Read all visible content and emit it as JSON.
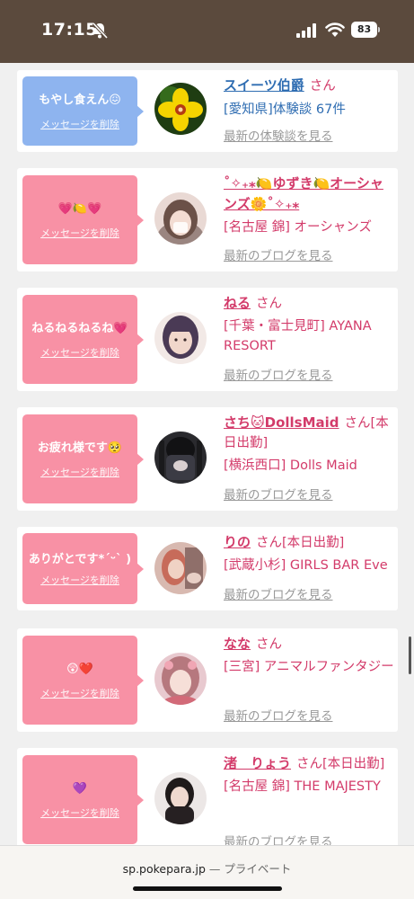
{
  "status_bar": {
    "time": "17:15",
    "battery": "83"
  },
  "feed": [
    {
      "bubble_text": "もやし食えん😖",
      "bubble_color": "#8eb4ef",
      "delete_label": "メッセージを削除",
      "name": "スイーツ伯爵",
      "name_suffix": "さん",
      "area": "[愛知県]体験談 67件",
      "link": "最新の体験談を見る",
      "accent": "blue"
    },
    {
      "bubble_text": "💗🍋💗",
      "bubble_color": "#f891a5",
      "delete_label": "メッセージを削除",
      "name": "˚✧₊⁎🍋ゆずき🍋オーシャンズ🌼˚✧₊⁎",
      "name_suffix": "",
      "area": "[名古屋 錦] オーシャンズ",
      "link": "最新のブログを見る",
      "accent": "pink"
    },
    {
      "bubble_text": "ねるねるねるね💗",
      "bubble_color": "#f891a5",
      "delete_label": "メッセージを削除",
      "name": "ねる",
      "name_suffix": "さん",
      "area": "[千葉・富士見町] AYANA RESORT",
      "link": "最新のブログを見る",
      "accent": "pink"
    },
    {
      "bubble_text": "お疲れ様です🥺",
      "bubble_color": "#f891a5",
      "delete_label": "メッセージを削除",
      "name": "さち🐱DollsMaid",
      "name_suffix": "さん[本日出勤]",
      "area": "[横浜西口] Dolls Maid",
      "link": "最新のブログを見る",
      "accent": "pink"
    },
    {
      "bubble_text": "ありがとです*ˊᵕˋ )",
      "bubble_color": "#f891a5",
      "delete_label": "メッセージを削除",
      "name": "りの",
      "name_suffix": "さん[本日出勤]",
      "area": "[武蔵小杉] GIRLS BAR Eve",
      "link": "最新のブログを見る",
      "accent": "pink"
    },
    {
      "bubble_text": "😲❤️",
      "bubble_color": "#f891a5",
      "delete_label": "メッセージを削除",
      "name": "なな",
      "name_suffix": "さん",
      "area": "[三宮] アニマルファンタジー",
      "link": "最新のブログを見る",
      "accent": "pink"
    },
    {
      "bubble_text": "💜",
      "bubble_color": "#f891a5",
      "delete_label": "メッセージを削除",
      "name": "渚　りょう",
      "name_suffix": "さん[本日出勤]",
      "area": "[名古屋 錦] THE MAJESTY",
      "link": "最新のブログを見る",
      "accent": "pink"
    }
  ],
  "url_bar": {
    "domain": "sp.pokepara.jp",
    "mode": "— プライベート"
  }
}
